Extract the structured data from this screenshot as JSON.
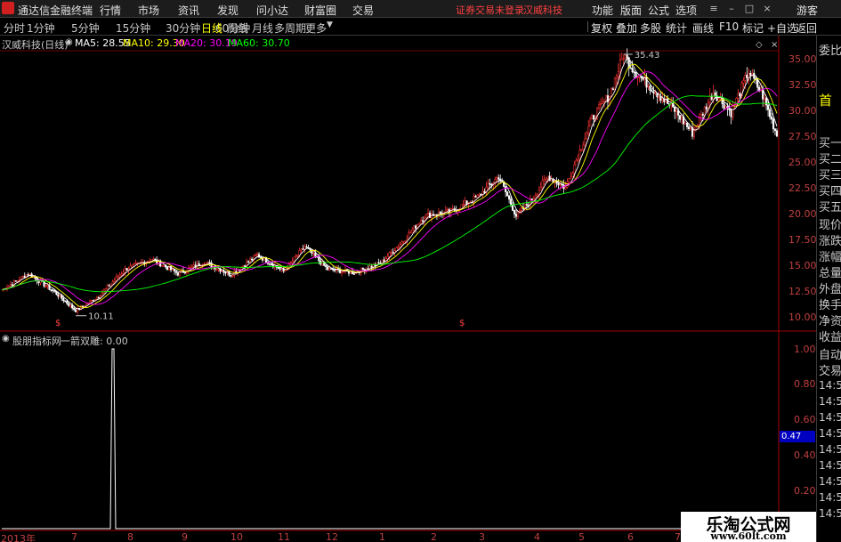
{
  "menubar": {
    "logo_glyph": "",
    "title": "通达信金融终端",
    "items": [
      "行情",
      "市场",
      "资讯",
      "发现",
      "问小达",
      "财富圈",
      "交易"
    ],
    "status": "证券交易未登录",
    "stock": "汉威科技",
    "right_items": [
      "功能",
      "版面",
      "公式",
      "选项"
    ],
    "guest": "游客"
  },
  "toolbar": {
    "periods": [
      "分时",
      "1分钟",
      "5分钟",
      "15分钟",
      "30分钟",
      "60分钟",
      "日线",
      "周线",
      "月线",
      "多周期",
      "更多"
    ],
    "active_period": "日线",
    "actions": [
      "复权",
      "叠加",
      "多股",
      "统计",
      "画线",
      "F10",
      "标记",
      "+自选",
      "返回"
    ]
  },
  "main_chart": {
    "title": "汉威科技(日线)",
    "ma": [
      {
        "label": "MA5: 28.55",
        "color": "#ffffff"
      },
      {
        "label": "MA10: 29.30",
        "color": "#ffff00"
      },
      {
        "label": "MA20: 30.19",
        "color": "#ff00ff"
      },
      {
        "label": "MA60: 30.70",
        "color": "#00ff00"
      }
    ],
    "high_label": "35.43",
    "low_label": "10.11",
    "axis": [
      "35.00",
      "32.50",
      "30.00",
      "27.50",
      "25.00",
      "22.50",
      "20.00",
      "17.50",
      "15.00",
      "12.50",
      "10.00"
    ]
  },
  "indicator": {
    "title": "股朋指标网",
    "line_label": "一箭双雕: 0.00",
    "axis": [
      "1.00",
      "0.80",
      "0.60",
      "0.40",
      "0.20"
    ],
    "marker_value": "0.47"
  },
  "sidepanel": {
    "items": [
      "委比",
      "首",
      "买一",
      "买二",
      "买三",
      "买四",
      "买五",
      "现价",
      "涨跌",
      "涨幅",
      "总量",
      "外盘",
      "换手",
      "净资",
      "收益",
      "自动",
      "交易",
      "14:55",
      "14:55",
      "14:55",
      "14:56",
      "14:56",
      "14:56",
      "14:56",
      "14:56",
      "14:56"
    ]
  },
  "dates": [
    "2013年",
    "7",
    "8",
    "9",
    "10",
    "11",
    "12",
    "1",
    "2",
    "3",
    "4",
    "5",
    "6",
    "7",
    "8",
    "9",
    "10",
    "11"
  ],
  "watermark": {
    "title": "乐淘公式网",
    "url": "www.60lt.com"
  }
}
